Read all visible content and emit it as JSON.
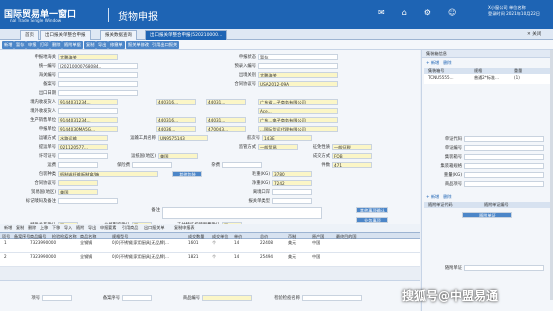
{
  "app": {
    "title_cn": "国际贸易单一窗口",
    "title_en": "nal Trade Single Window",
    "system": "货物申报",
    "user": "X小窗公司 单位名称",
    "date": "登录时间 2021年10月22日"
  },
  "topbar_icons": [
    "bell-icon",
    "home-icon",
    "settings-icon",
    "user-icon"
  ],
  "tabs": [
    "首页",
    "出口报关单整合申报",
    "报关数据查询",
    "出口报关单整合申报(520210000..."
  ],
  "toolbar": [
    "新增",
    "暂存",
    "申报",
    "打印",
    "删除",
    "随附单据",
    "复制",
    "导出",
    "修撤单",
    "报关单修改",
    "引用出口报关"
  ],
  "form": {
    "l1a": "申报地海关",
    "v1a": "大鹏海关",
    "l1b": "申报状态",
    "v1b": "暂存",
    "l2a": "统一编号",
    "v2a": "I20210000768084..",
    "l2b": "预录入编号",
    "v2b": "",
    "l3a": "海关编号",
    "v3a": "",
    "l3b": "出境关别",
    "v3b": "大鹏海关",
    "l4a": "备案号",
    "v4a": "",
    "l4b": "合同协议号",
    "v4b": "USA2012-09A",
    "l5a": "出口日期",
    "v5a": "",
    "l6a": "境内收发货人",
    "v6a": "9144031234...",
    "v6b": "440316...",
    "v6c": "44031...",
    "v6d": "广东省...子商务有限公司",
    "l7a": "境外收发货人",
    "v7a": "",
    "v7d": "Ace...",
    "l8a": "生产销售单位",
    "v8a": "9144031234...",
    "v8b": "440316...",
    "v8c": "44031...",
    "v8d": "广东...电子商务有限公司",
    "l9a": "申报单位",
    "v9a": "9144030MA5G...",
    "v9b": "44036...",
    "v9c": "470043...",
    "v9d": "...国际货运代理有限公司",
    "l10a": "运输方式",
    "v10a": "水路运输",
    "l10b": "运输工具名称",
    "v10b": "UN9575143",
    "l10c": "航次号",
    "v10c": "143E",
    "l11a": "提运单号",
    "v11a": "021120577...",
    "l11b": "监管方式",
    "v11b": "一般贸易",
    "l11c": "征免性质",
    "v11c": "一般征税",
    "l12a": "许可证号",
    "v12a": "",
    "l12b": "运抵国(地区)",
    "v12b": "美国",
    "l12c": "成交方式",
    "v12c": "FOB",
    "l13a": "运费",
    "l13b": "保险费",
    "l13c": "杂费",
    "l13d": "件数",
    "v13d": "471",
    "l14a": "包装种类",
    "v14a": "纸制或纤维板制盒/箱",
    "l14b": "毛重(KG)",
    "v14b": "3780",
    "l15a": "合同协议号",
    "v15a": "",
    "l15b": "净重(KG)",
    "v15b": "7242",
    "l16a": "贸易国(地区)",
    "v16a": "美国",
    "l16b": "离境口岸",
    "v16b": "",
    "l17a": "标记唛码及备注",
    "v17a": "",
    "l17b": "报关单类型",
    "v17b": "",
    "l18a": "备注",
    "v18a": "",
    "l19a": "特殊关系确认",
    "v19a": "否",
    "l19b": "价格影响确认",
    "v19b": "否",
    "l19c": "支付特许权使用费确认",
    "v19c": "否",
    "btn1": "其他事项确认",
    "btn2": "业务事项",
    "btn3": "报关单附件"
  },
  "grid_toolbar": [
    "新增",
    "复制",
    "删除",
    "上移",
    "下移",
    "导入",
    "随附",
    "导出",
    "申报要素",
    "引用商品",
    "出口报关单",
    "复制申报表"
  ],
  "grid_headers": [
    "项号",
    "备案序号",
    "商品编号",
    "检验检疫名称",
    "商品名称",
    "规格型号",
    "成交数量",
    "成交单位",
    "单价",
    "总价",
    "币制",
    "原产国",
    "最终目的国"
  ],
  "grid_rows": [
    [
      "1",
      "",
      "7323990000",
      "",
      "全钢锅",
      "0|0|不锈钢|家用厨具|无品牌|...",
      "1601",
      "个",
      "14",
      "22408",
      "美元",
      "中国"
    ],
    [
      "2",
      "",
      "7323990000",
      "",
      "全钢锅",
      "0|0|不锈钢|家用厨具|无品牌|...",
      "1821",
      "个",
      "14",
      "25494",
      "美元",
      "中国"
    ]
  ],
  "bottom": {
    "l1": "项号",
    "l2": "备案序号",
    "l3": "商品编号",
    "l4": "检验检疫名称"
  },
  "right": {
    "title": "集装箱信息",
    "cols": [
      "集装箱号",
      "规格",
      "重量"
    ],
    "row": [
      "TCNU5555...",
      "普通2*标准...",
      "(1)"
    ],
    "labels": [
      "单证代码",
      "单证编号",
      "集装箱号",
      "集装箱规格",
      "重量(KG)",
      "商品项号"
    ],
    "section2": "随附单证",
    "section3": "随附单证代码",
    "section4": "随附单证编号",
    "btn": "随附单证"
  },
  "watermark": "搜狐号@中盟易通"
}
